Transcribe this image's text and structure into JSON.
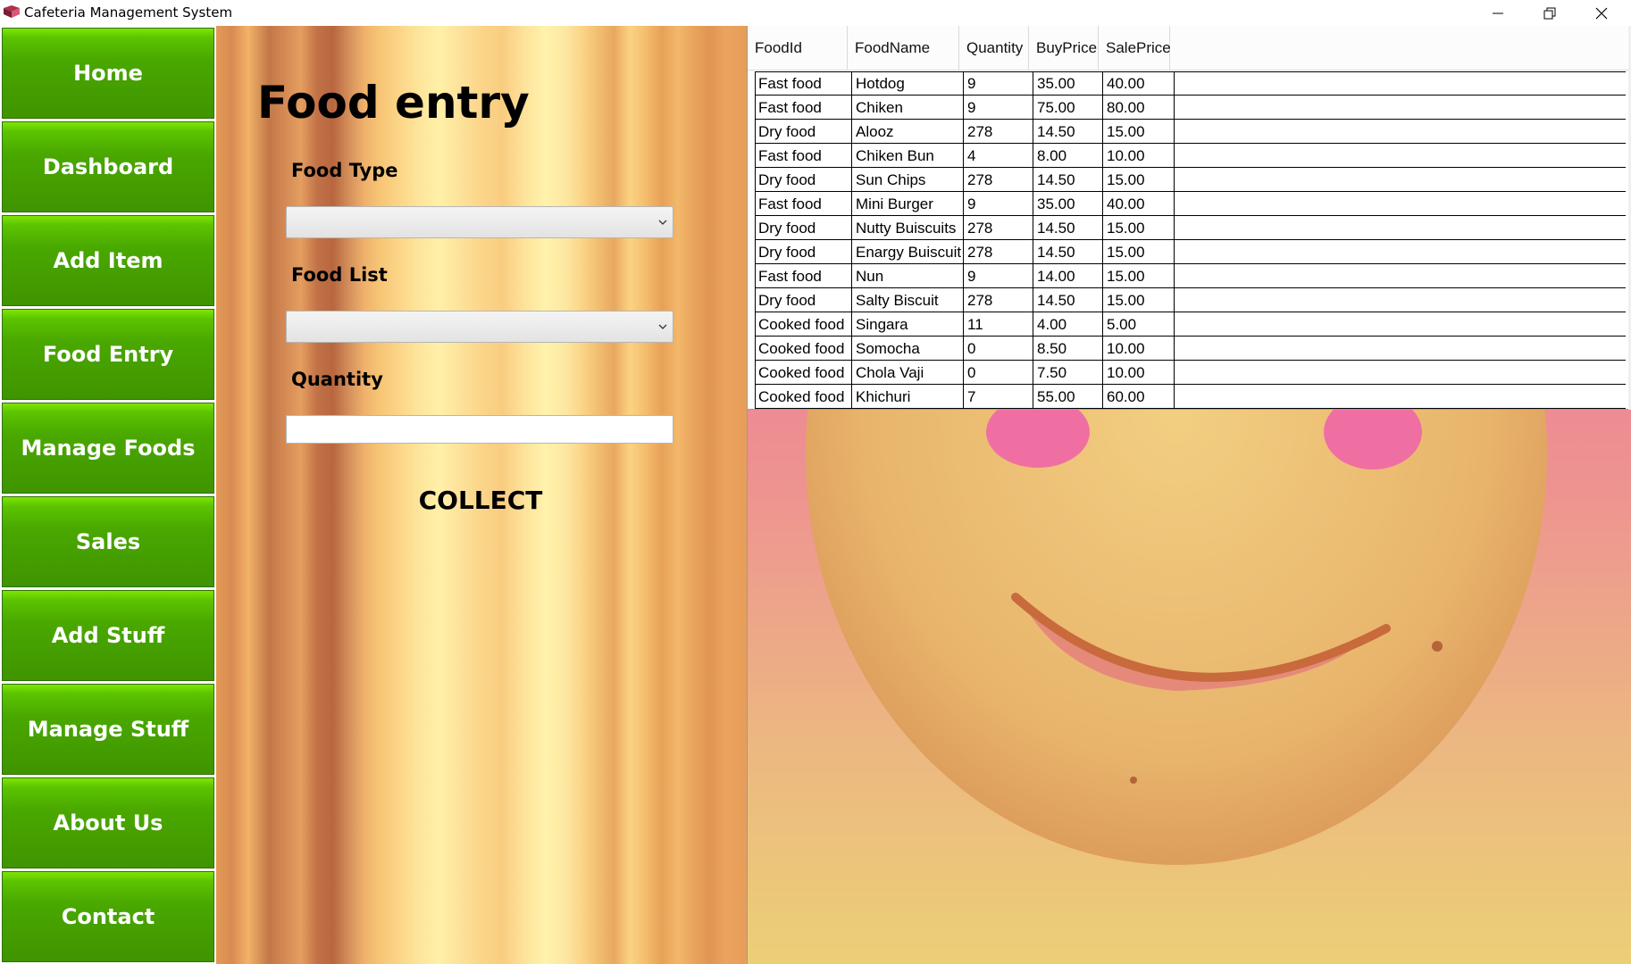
{
  "window": {
    "title": "Cafeteria Management System",
    "minimize_icon": "minimize-icon",
    "restore_icon": "restore-icon",
    "close_icon": "close-icon"
  },
  "sidebar": {
    "items": [
      {
        "label": "Home"
      },
      {
        "label": "Dashboard"
      },
      {
        "label": "Add Item"
      },
      {
        "label": "Food Entry"
      },
      {
        "label": "Manage Foods"
      },
      {
        "label": "Sales"
      },
      {
        "label": "Add Stuff"
      },
      {
        "label": "Manage Stuff"
      },
      {
        "label": "About Us"
      },
      {
        "label": "Contact"
      }
    ],
    "accent": "#4aa800"
  },
  "form": {
    "title": "Food entry",
    "food_type_label": "Food Type",
    "food_type_value": "",
    "food_list_label": "Food List",
    "food_list_value": "",
    "quantity_label": "Quantity",
    "quantity_value": "",
    "collect_label": "COLLECT"
  },
  "table": {
    "columns": [
      "FoodId",
      "FoodName",
      "Quantity",
      "BuyPrice",
      "SalePrice"
    ],
    "rows": [
      [
        "Fast food",
        "Hotdog",
        "9",
        "35.00",
        "40.00"
      ],
      [
        "Fast food",
        "Chiken",
        "9",
        "75.00",
        "80.00"
      ],
      [
        "Dry food",
        "Alooz",
        "278",
        "14.50",
        "15.00"
      ],
      [
        "Fast food",
        "Chiken Bun",
        "4",
        "8.00",
        "10.00"
      ],
      [
        "Dry food",
        "Sun Chips",
        "278",
        "14.50",
        "15.00"
      ],
      [
        "Fast food",
        "Mini Burger",
        "9",
        "35.00",
        "40.00"
      ],
      [
        "Dry food",
        "Nutty Buiscuits",
        "278",
        "14.50",
        "15.00"
      ],
      [
        "Dry food",
        "Enargy Buiscuit",
        "278",
        "14.50",
        "15.00"
      ],
      [
        "Fast food",
        "Nun",
        "9",
        "14.00",
        "15.00"
      ],
      [
        "Dry food",
        "Salty Biscuit",
        "278",
        "14.50",
        "15.00"
      ],
      [
        "Cooked food",
        "Singara",
        "11",
        "4.00",
        "5.00"
      ],
      [
        "Cooked food",
        "Somocha",
        "0",
        "8.50",
        "10.00"
      ],
      [
        "Cooked food",
        "Chola Vaji",
        "0",
        "7.50",
        "10.00"
      ],
      [
        "Cooked food",
        "Khichuri",
        "7",
        "55.00",
        "60.00"
      ]
    ]
  }
}
